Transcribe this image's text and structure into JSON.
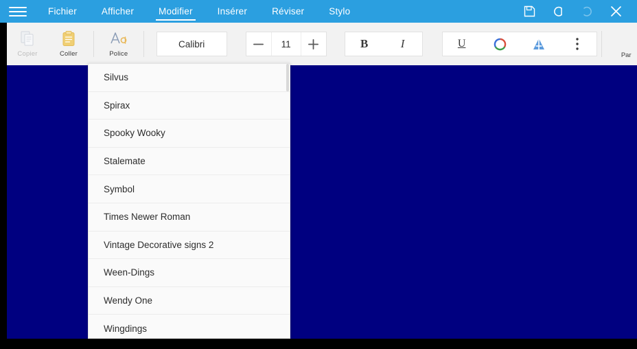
{
  "menubar": {
    "hamburger_name": "menu-icon",
    "items": [
      {
        "label": "Fichier",
        "active": false
      },
      {
        "label": "Afficher",
        "active": false
      },
      {
        "label": "Modifier",
        "active": true
      },
      {
        "label": "Insérer",
        "active": false
      },
      {
        "label": "Réviser",
        "active": false
      },
      {
        "label": "Stylo",
        "active": false
      }
    ],
    "actions": [
      {
        "name": "save-icon",
        "label": "Enregistrer"
      },
      {
        "name": "undo-icon",
        "label": "Annuler"
      },
      {
        "name": "redo-icon",
        "label": "Rétablir"
      },
      {
        "name": "close-icon",
        "label": "Fermer"
      }
    ],
    "bg_color": "#2b9fe0",
    "text_color": "#ffffff"
  },
  "toolbar": {
    "copy_label": "Copier",
    "paste_label": "Coller",
    "font_label": "Police",
    "paragraph_label": "Par",
    "font_name": "Calibri",
    "font_size": "11",
    "decrease_label": "—",
    "increase_label": "+",
    "bold_label": "B",
    "italic_label": "I",
    "underline_label": "U",
    "copy_disabled": true,
    "paste_icon_color": "#f0cf74",
    "font_icon_color_a": "#8a9bb5",
    "font_icon_color_b": "#e8b757",
    "highlight_icon_color": "#4a90d9",
    "more_label": "Plus d'options"
  },
  "font_dropdown": {
    "visible": true,
    "items": [
      {
        "label": "Silvus"
      },
      {
        "label": "Spirax"
      },
      {
        "label": "Spooky Wooky"
      },
      {
        "label": "Stalemate"
      },
      {
        "label": "Symbol"
      },
      {
        "label": "Times Newer Roman"
      },
      {
        "label": "Vintage Decorative signs 2"
      },
      {
        "label": "Ween-Dings"
      },
      {
        "label": "Wendy One"
      },
      {
        "label": "Wingdings"
      }
    ]
  },
  "document": {
    "background_color": "#000080"
  }
}
